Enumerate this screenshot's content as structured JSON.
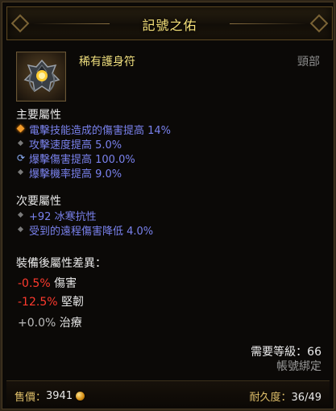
{
  "item": {
    "name": "記號之佑",
    "type": "稀有護身符",
    "slot": "頸部"
  },
  "primary": {
    "title": "主要屬性",
    "affixes": [
      {
        "text": "電擊技能造成的傷害提高 14%",
        "bullet": "orange-diamond-icon"
      },
      {
        "text": "攻擊速度提高 5.0%",
        "bullet": "grey-diamond-icon"
      },
      {
        "text": "爆擊傷害提高 100.0%",
        "bullet": "reroll-cycle-icon"
      },
      {
        "text": "爆擊機率提高 9.0%",
        "bullet": "grey-diamond-icon"
      }
    ]
  },
  "secondary": {
    "title": "次要屬性",
    "affixes": [
      {
        "text": "+92 冰寒抗性",
        "bullet": "grey-diamond-icon"
      },
      {
        "text": "受到的遠程傷害降低 4.0%",
        "bullet": "grey-diamond-icon"
      }
    ]
  },
  "compare": {
    "title": "裝備後屬性差異：",
    "rows": [
      {
        "value": "-0.5%",
        "label": "傷害"
      },
      {
        "value": "-12.5%",
        "label": "堅韌"
      },
      {
        "value": "+0.0%",
        "label": "治療"
      }
    ]
  },
  "requirements": {
    "level": "需要等級：66",
    "binding": "帳號綁定"
  },
  "footer": {
    "price_label": "售價：",
    "price_value": "3941",
    "durability_label": "耐久度：",
    "durability_value": "36/49"
  },
  "colors": {
    "title": "#f6e27a",
    "affix": "#7a82ee",
    "negative": "#ff3a2e",
    "bound": "#9a9a9a"
  }
}
